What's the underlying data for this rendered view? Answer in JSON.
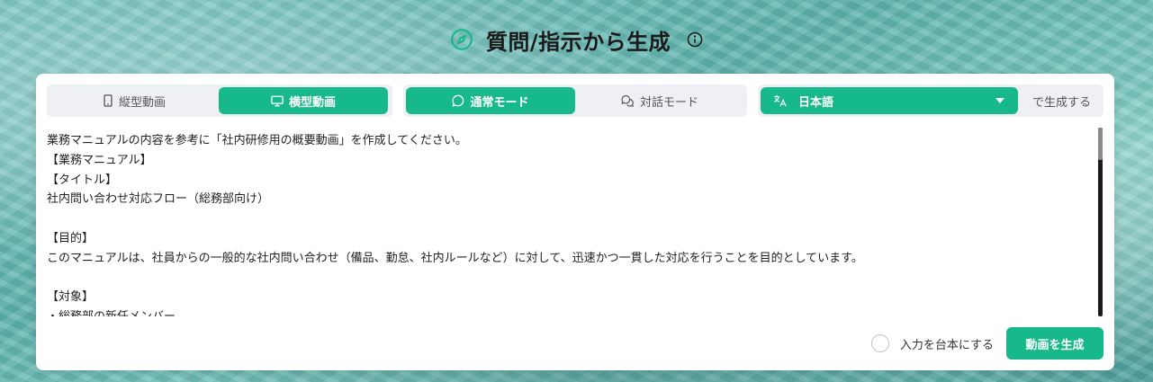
{
  "header": {
    "title": "質問/指示から生成",
    "compass_icon": "compass-icon",
    "info_icon": "info-icon"
  },
  "orientation": {
    "options": [
      {
        "label": "縦型動画",
        "icon": "smartphone-icon",
        "active": false
      },
      {
        "label": "横型動画",
        "icon": "monitor-icon",
        "active": true
      }
    ]
  },
  "mode": {
    "options": [
      {
        "label": "通常モード",
        "icon": "chat-bubble-icon",
        "active": true
      },
      {
        "label": "対話モード",
        "icon": "chat-bubbles-icon",
        "active": false
      }
    ]
  },
  "language": {
    "selected": "日本語",
    "icon": "translate-icon",
    "suffix": "で生成する"
  },
  "prompt": {
    "text": "業務マニュアルの内容を参考に「社内研修用の概要動画」を作成してください。\n【業務マニュアル】\n【タイトル】\n社内問い合わせ対応フロー（総務部向け）\n\n【目的】\nこのマニュアルは、社員からの一般的な社内問い合わせ（備品、勤怠、社内ルールなど）に対して、迅速かつ一貫した対応を行うことを目的としています。\n\n【対象】\n・総務部の新任メンバー"
  },
  "footer": {
    "checkbox_label": "入力を台本にする",
    "checkbox_checked": false,
    "generate_label": "動画を生成"
  },
  "colors": {
    "accent": "#17b889",
    "text": "#1a1a1a"
  }
}
